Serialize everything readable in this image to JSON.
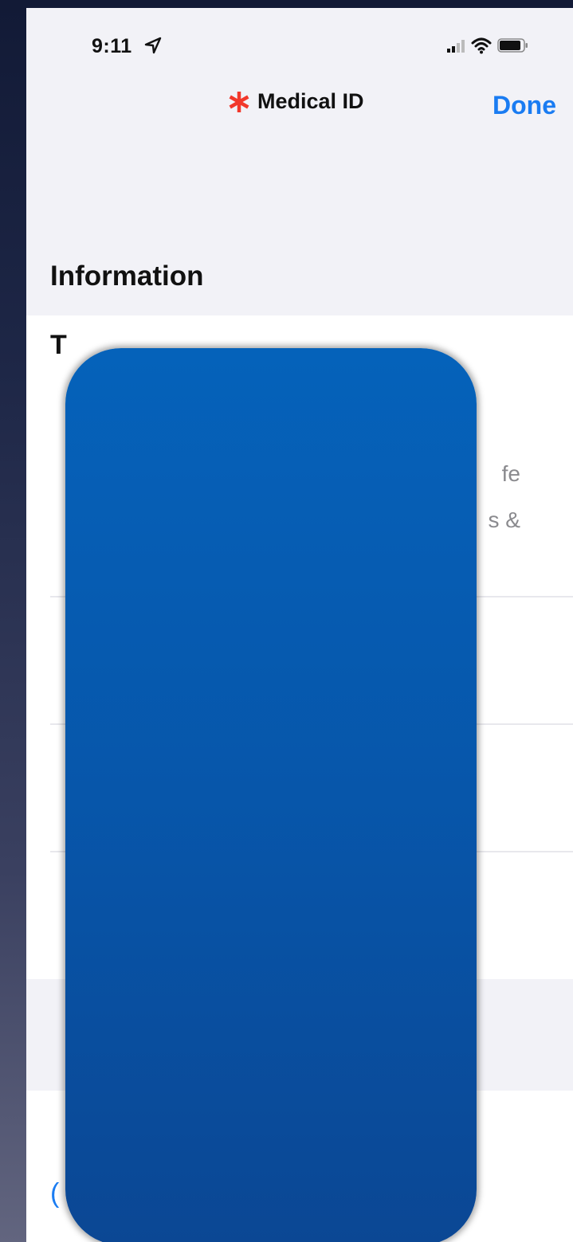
{
  "status_bar": {
    "time": "9:11",
    "location_icon": "location-arrow-icon",
    "signal_icon": "cellular-signal-icon",
    "wifi_icon": "wifi-icon",
    "battery_icon": "battery-icon"
  },
  "nav": {
    "icon": "medical-asterisk-icon",
    "title": "Medical ID",
    "done_label": "Done"
  },
  "section": {
    "header": "Information"
  },
  "info": {
    "intro_fragment": "T",
    "desc_line_1": "fe",
    "desc_line_2": "s &"
  },
  "bottom": {
    "link_fragment": "("
  },
  "colors": {
    "accent": "#1a7cf2",
    "medical_red": "#f2382b",
    "redaction_blue": "#0562ba",
    "background": "#f2f2f7"
  }
}
